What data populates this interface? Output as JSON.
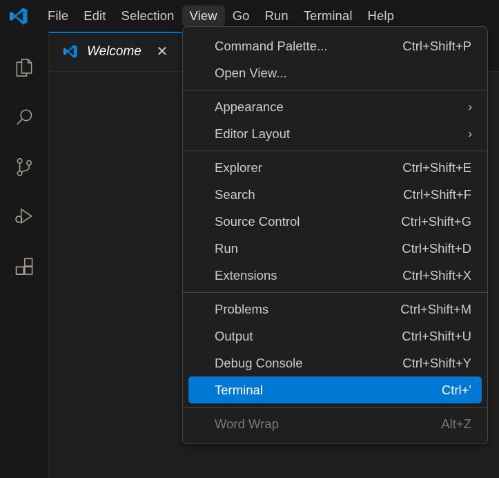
{
  "app": {
    "logo_icon": "vscode-logo",
    "accent_color": "#0078d4",
    "background_color": "#1f1f1f",
    "titlebar_color": "#181818"
  },
  "menubar": {
    "items": [
      {
        "label": "File",
        "active": false
      },
      {
        "label": "Edit",
        "active": false
      },
      {
        "label": "Selection",
        "active": false
      },
      {
        "label": "View",
        "active": true
      },
      {
        "label": "Go",
        "active": false
      },
      {
        "label": "Run",
        "active": false
      },
      {
        "label": "Terminal",
        "active": false
      },
      {
        "label": "Help",
        "active": false
      }
    ]
  },
  "activitybar": {
    "items": [
      {
        "name": "explorer",
        "icon": "files-icon"
      },
      {
        "name": "search",
        "icon": "search-icon"
      },
      {
        "name": "source-control",
        "icon": "source-control-icon"
      },
      {
        "name": "run-and-debug",
        "icon": "run-debug-icon"
      },
      {
        "name": "extensions",
        "icon": "extensions-icon"
      }
    ]
  },
  "tabs": [
    {
      "label": "Welcome",
      "icon": "vscode-logo-icon",
      "close_glyph": "✕",
      "active": true
    }
  ],
  "view_menu": {
    "title": "View",
    "groups": [
      {
        "items": [
          {
            "label": "Command Palette...",
            "keybinding": "Ctrl+Shift+P",
            "submenu": false,
            "selected": false,
            "disabled": false
          },
          {
            "label": "Open View...",
            "keybinding": "",
            "submenu": false,
            "selected": false,
            "disabled": false
          }
        ]
      },
      {
        "items": [
          {
            "label": "Appearance",
            "keybinding": "",
            "submenu": true,
            "selected": false,
            "disabled": false
          },
          {
            "label": "Editor Layout",
            "keybinding": "",
            "submenu": true,
            "selected": false,
            "disabled": false
          }
        ]
      },
      {
        "items": [
          {
            "label": "Explorer",
            "keybinding": "Ctrl+Shift+E",
            "submenu": false,
            "selected": false,
            "disabled": false
          },
          {
            "label": "Search",
            "keybinding": "Ctrl+Shift+F",
            "submenu": false,
            "selected": false,
            "disabled": false
          },
          {
            "label": "Source Control",
            "keybinding": "Ctrl+Shift+G",
            "submenu": false,
            "selected": false,
            "disabled": false
          },
          {
            "label": "Run",
            "keybinding": "Ctrl+Shift+D",
            "submenu": false,
            "selected": false,
            "disabled": false
          },
          {
            "label": "Extensions",
            "keybinding": "Ctrl+Shift+X",
            "submenu": false,
            "selected": false,
            "disabled": false
          }
        ]
      },
      {
        "items": [
          {
            "label": "Problems",
            "keybinding": "Ctrl+Shift+M",
            "submenu": false,
            "selected": false,
            "disabled": false
          },
          {
            "label": "Output",
            "keybinding": "Ctrl+Shift+U",
            "submenu": false,
            "selected": false,
            "disabled": false
          },
          {
            "label": "Debug Console",
            "keybinding": "Ctrl+Shift+Y",
            "submenu": false,
            "selected": false,
            "disabled": false
          },
          {
            "label": "Terminal",
            "keybinding": "Ctrl+'",
            "submenu": false,
            "selected": true,
            "disabled": false
          }
        ]
      },
      {
        "items": [
          {
            "label": "Word Wrap",
            "keybinding": "Alt+Z",
            "submenu": false,
            "selected": false,
            "disabled": true
          }
        ]
      }
    ],
    "submenu_arrow_glyph": "›"
  }
}
